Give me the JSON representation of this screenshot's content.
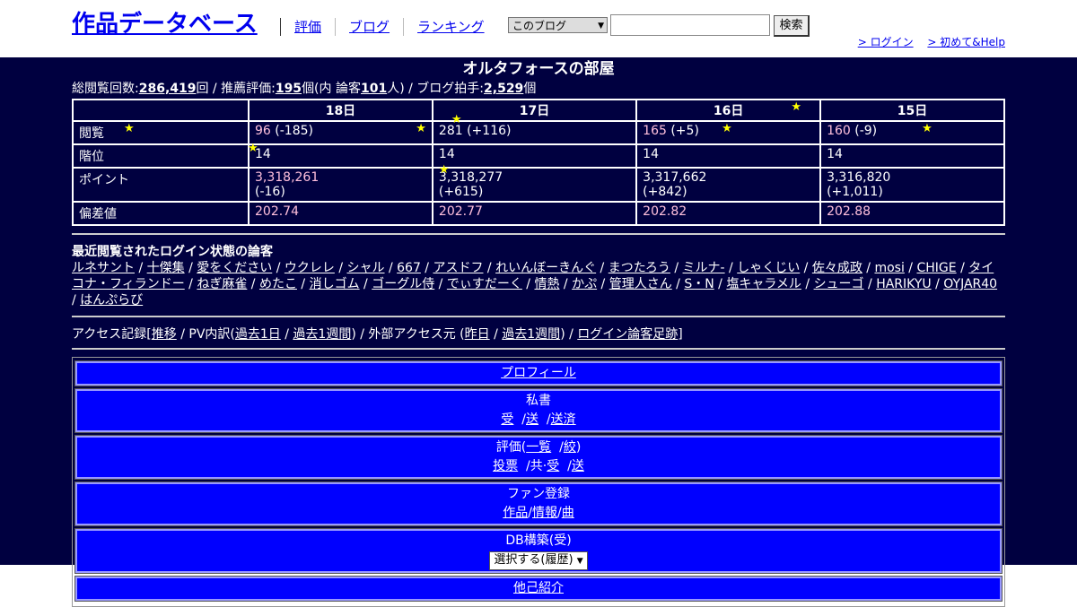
{
  "header": {
    "site_title": "作品データベース",
    "nav": [
      "評価",
      "ブログ",
      "ランキング"
    ],
    "select_value": "このブログ",
    "search_button": "検索",
    "login_link": "> ログイン",
    "help_link": "> 初めて&Help"
  },
  "page": {
    "title": "オルタフォースの部屋",
    "stats_prefix": "総閲覧回数:",
    "views_total": "286,419",
    "stats_mid1": "回 / 推薦評価:",
    "recommend": "195",
    "stats_mid2": "個(内 論客",
    "critics": "101",
    "stats_mid3": "人) / ブログ拍手:",
    "claps": "2,529",
    "stats_suffix": "個"
  },
  "table": {
    "days": [
      "18日",
      "17日",
      "16日",
      "15日"
    ],
    "rows": [
      {
        "label": "閲覧",
        "cells": [
          {
            "a": "96",
            "b": " (-185)"
          },
          {
            "a": "281",
            "b": " (+116)"
          },
          {
            "a": "165",
            "b": " (+5)"
          },
          {
            "a": "160",
            "b": " (-9)"
          }
        ]
      },
      {
        "label": "階位",
        "cells": [
          {
            "a": "14"
          },
          {
            "a": "14"
          },
          {
            "a": "14"
          },
          {
            "a": "14"
          }
        ]
      },
      {
        "label": "ポイント",
        "cells": [
          {
            "a": "3,318,261",
            "b": "(-16)"
          },
          {
            "a": "3,318,277",
            "b": "(+615)"
          },
          {
            "a": "3,317,662",
            "b": "(+842)"
          },
          {
            "a": "3,316,820",
            "b": "(+1,011)"
          }
        ]
      },
      {
        "label": "偏差値",
        "cells": [
          {
            "a": "202.74"
          },
          {
            "a": "202.77"
          },
          {
            "a": "202.82"
          },
          {
            "a": "202.88"
          }
        ]
      }
    ]
  },
  "recent": {
    "title": "最近閲覧されたログイン状態の論客",
    "users": [
      "ルネサント",
      "十傑集",
      "愛をください",
      "ウクレレ",
      "シャル",
      "667",
      "アスドフ",
      "れいんぼーきんぐ",
      "まつたろう",
      "ミルナ-",
      "しゃくじい",
      "佐々成政",
      "mosi",
      "CHIGE",
      "タイコナ・フィランドー",
      "ねぎ麻雀",
      "めたこ",
      "消しゴム",
      "ゴーグル侍",
      "でぃすだーく",
      "情熱",
      "かぷ",
      "管理人さん",
      "S・N",
      "塩キャラメル",
      "シューゴ",
      "HARIKYU",
      "OYJAR40",
      "はんぷらび"
    ]
  },
  "access": {
    "label1": "アクセス記録[",
    "link_trend": "推移",
    "label2": " / PV内訳(",
    "link_1day": "過去1日",
    "sep1": " / ",
    "link_1week": "過去1週間",
    "label3": ") / 外部アクセス元 (",
    "link_yesterday": "昨日",
    "sep2": " / ",
    "link_1week2": "過去1週間",
    "label4": ") / ",
    "link_footprint": "ログイン論客足跡",
    "label5": "]"
  },
  "menu": {
    "profile": "プロフィール",
    "mail_title": "私書",
    "mail_recv": "受",
    "mail_send": "送",
    "mail_sent": "送済",
    "eval_title_pre": "評価(",
    "eval_list": "一覧",
    "eval_narrow": "絞",
    "eval_close": ")",
    "vote": "投票",
    "kyo_pre": "/共·",
    "kyo_recv": "受",
    "kyo_send": "送",
    "fan_title": "ファン登録",
    "fan_work": "作品",
    "fan_info": "情報",
    "fan_song": "曲",
    "db_title": "DB構築(受)",
    "db_select": "選択する(履歴)",
    "self_intro": "他己紹介"
  },
  "colors": {
    "accent_blue": "#0000ff",
    "background_dark": "#000040",
    "star": "#ffff00",
    "pink_value": "#ffc0dc"
  }
}
